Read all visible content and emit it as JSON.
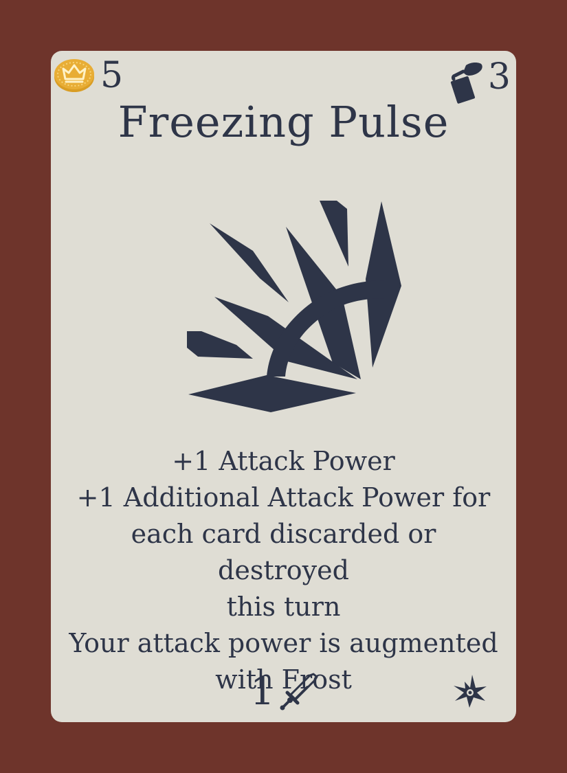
{
  "card": {
    "cost": "5",
    "draw": "3",
    "title": "Freezing Pulse",
    "effects": [
      "+1 Attack Power",
      "+1 Additional Attack Power for",
      "each card discarded or destroyed",
      "this turn",
      "Your attack power is augmented",
      "with Frost"
    ],
    "attack": "1"
  },
  "icons": {
    "cost": "coin-crown-icon",
    "draw": "hand-card-icon",
    "art": "freezing-pulse-art",
    "attack": "sword-icon",
    "element": "frost-icon"
  },
  "colors": {
    "background": "#6e342b",
    "card": "#dfddd4",
    "ink": "#2e3548",
    "coin": "#e3a72f"
  }
}
